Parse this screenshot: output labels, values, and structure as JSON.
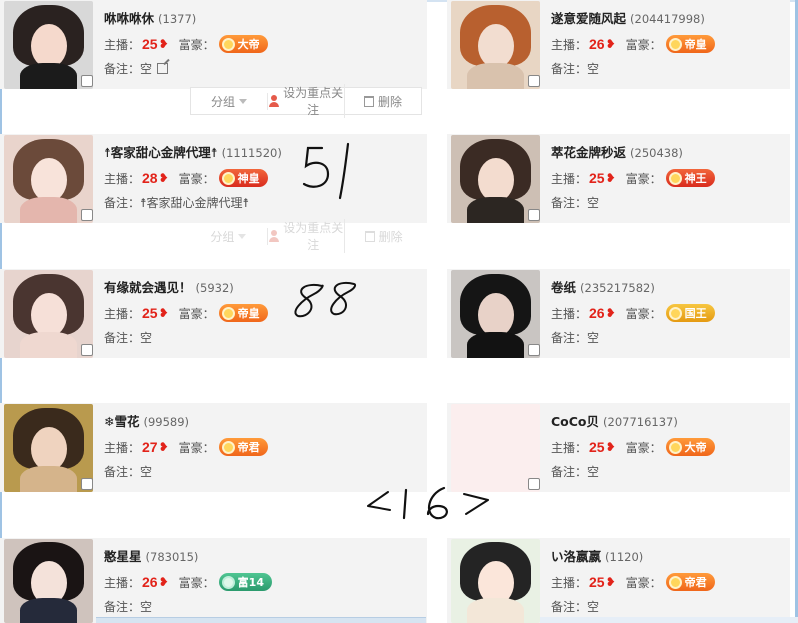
{
  "labels": {
    "anchor": "主播：",
    "rich": "富豪：",
    "note": "备注：",
    "heart": "❥"
  },
  "actions": {
    "group": "分组",
    "follow": "设为重点关注",
    "delete": "删除"
  },
  "cards": [
    {
      "name": "咻咻咻休",
      "uid": "(1377)",
      "anchor_level": "25",
      "rich_badge": "大帝",
      "note": "空",
      "checked": false
    },
    {
      "name": "遂意爱随风起",
      "uid": "(204417998)",
      "anchor_level": "26",
      "rich_badge": "帝皇",
      "note": "空",
      "checked": false
    },
    {
      "name": "☨客家甜心金牌代理☨",
      "uid": "(1111520)",
      "anchor_level": "28",
      "rich_badge": "神皇",
      "note": "☨客家甜心金牌代理☨",
      "checked": false
    },
    {
      "name": "萃花金牌秒返",
      "uid": "(250438)",
      "anchor_level": "25",
      "rich_badge": "神王",
      "note": "空",
      "checked": false
    },
    {
      "name": "有缘就会遇见！",
      "uid": "(5932)",
      "anchor_level": "25",
      "rich_badge": "帝皇",
      "note": "空",
      "checked": false
    },
    {
      "name": "卷纸",
      "uid": "(235217582)",
      "anchor_level": "26",
      "rich_badge": "国王",
      "note": "空",
      "checked": false
    },
    {
      "name": "❄雪花",
      "uid": "(99589)",
      "anchor_level": "27",
      "rich_badge": "帝君",
      "note": "空",
      "checked": false
    },
    {
      "name": "CoCo贝",
      "uid": "(207716137)",
      "anchor_level": "25",
      "rich_badge": "大帝",
      "note": "空",
      "checked": false
    },
    {
      "name": "憨星星",
      "uid": "(783015)",
      "anchor_level": "26",
      "rich_badge": "富14",
      "note": "空",
      "checked": false
    },
    {
      "name": "い洛嬴嬴",
      "uid": "(1120)",
      "anchor_level": "25",
      "rich_badge": "帝君",
      "note": "空",
      "checked": false
    }
  ],
  "handwriting": {
    "a": "51",
    "b": "88",
    "c": "<16>"
  },
  "colors": {
    "card_bg": "#f3f3f3",
    "level_red": "#e2231a",
    "badge_orange": "#f0661a",
    "badge_red": "#d92b1d",
    "badge_gold": "#e59a12",
    "badge_green": "#2b9a6d"
  }
}
